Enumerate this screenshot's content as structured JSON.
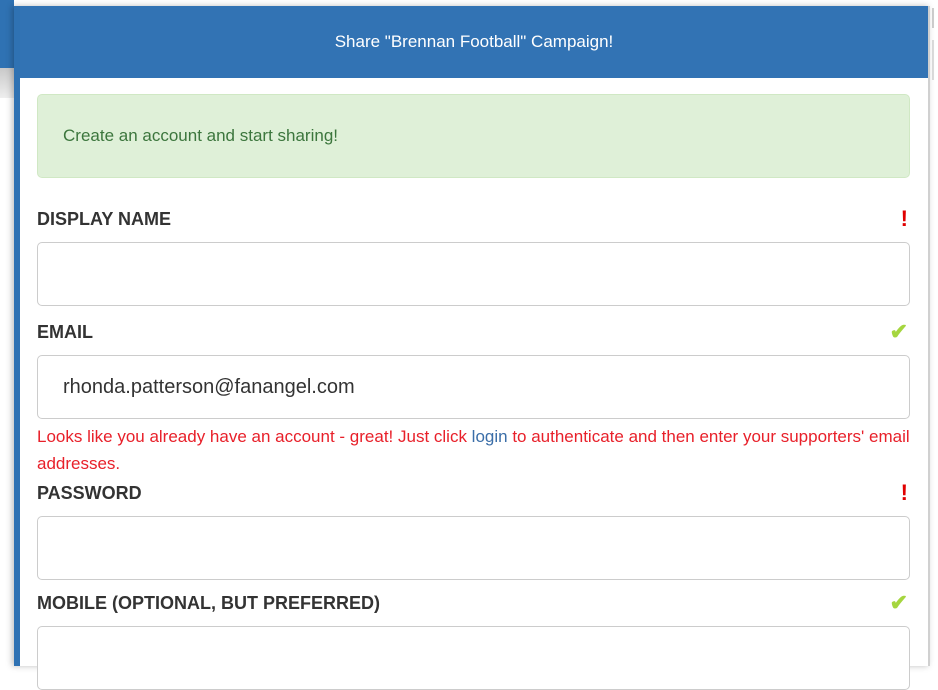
{
  "modal": {
    "title": "Share \"Brennan Football\" Campaign!"
  },
  "alert": {
    "message": "Create an account and start sharing!"
  },
  "fields": {
    "display_name": {
      "label": "DISPLAY NAME",
      "value": "",
      "status": "required",
      "status_glyph": "!"
    },
    "email": {
      "label": "EMAIL",
      "value": "rhonda.patterson@fanangel.com",
      "status": "valid",
      "status_glyph": "✔",
      "error_before": "Looks like you already have an account - great! Just click ",
      "error_link": "login",
      "error_after": " to authenticate and then enter your supporters' email addresses."
    },
    "password": {
      "label": "PASSWORD",
      "value": "",
      "status": "required",
      "status_glyph": "!"
    },
    "mobile": {
      "label": "MOBILE (OPTIONAL, BUT PREFERRED)",
      "value": "",
      "status": "valid",
      "status_glyph": "✔"
    }
  },
  "colors": {
    "header_blue": "#3273b4",
    "alert_bg": "#dff0d8",
    "alert_text": "#3c763d",
    "error_red": "#e8202a",
    "required_red": "#e00000",
    "valid_green": "#a5d63f",
    "link_blue": "#3b6ea8"
  },
  "icons": {
    "required": "exclamation-icon",
    "valid": "checkmark-icon"
  }
}
